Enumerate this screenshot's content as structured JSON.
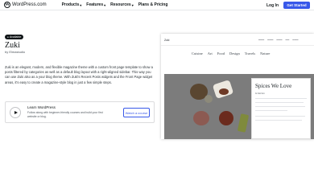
{
  "topbar": {
    "brand": "WordPress.com",
    "nav": [
      {
        "label": "Products",
        "has_dropdown": true
      },
      {
        "label": "Features",
        "has_dropdown": true
      },
      {
        "label": "Resources",
        "has_dropdown": true
      },
      {
        "label": "Plans & Pricing",
        "has_dropdown": false
      }
    ],
    "login_label": "Log In",
    "get_started_label": "Get Started",
    "accent_color": "#3858e9"
  },
  "theme": {
    "badge": "Available",
    "title": "Zuki",
    "author_prefix": "by",
    "author": "Elmastudio",
    "description": "Zuki is an elegant, modern, and flexible magazine theme with a custom front page template to show a posts filtered by categories as well as a default blog layout with a right-aligned sidebar. This way you can use Zuki also as a your blog theme. With Zuki's Recent Posts widgets and the Front Page widget areas, it's easy to create a magazine-style blog in just a few simple steps."
  },
  "learn": {
    "title": "Learn WordPress",
    "subtitle": "Follow along with beginner-friendly courses and build your first website or blog.",
    "button_label": "Watch a course"
  },
  "preview": {
    "site_name": "Zuki",
    "top_links": [
      "",
      "",
      "",
      "",
      ""
    ],
    "menu": [
      "Cuisine",
      "Art",
      "Food",
      "Design",
      "Travels",
      "Nature"
    ],
    "featured_title": "Spices We Love",
    "featured_meta": "In Kitchen"
  }
}
